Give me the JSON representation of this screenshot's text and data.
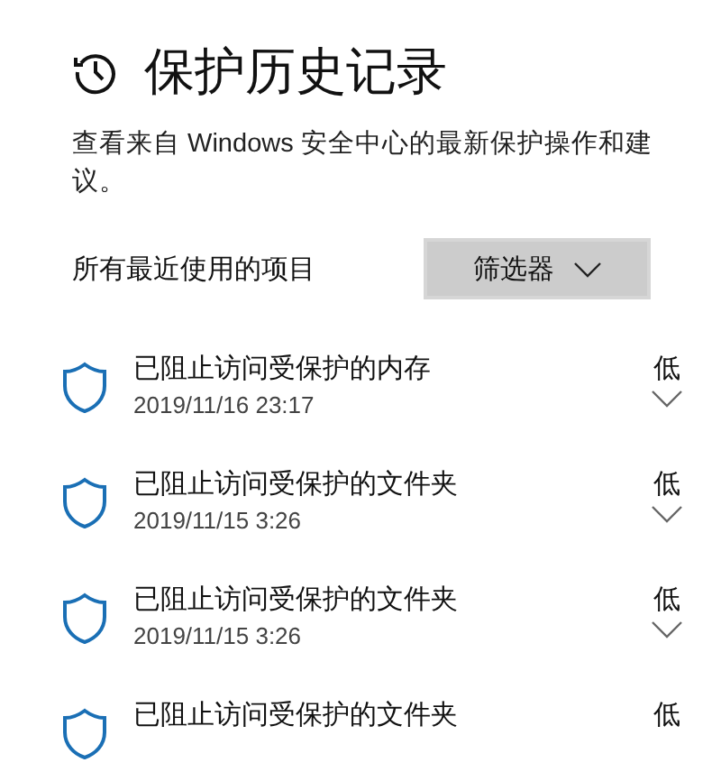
{
  "header": {
    "title": "保护历史记录",
    "description": "查看来自 Windows 安全中心的最新保护操作和建议。"
  },
  "filter_bar": {
    "label": "所有最近使用的项目",
    "button": "筛选器"
  },
  "items": [
    {
      "title": "已阻止访问受保护的内存",
      "date": "2019/11/16 23:17",
      "severity": "低",
      "expanded": false
    },
    {
      "title": "已阻止访问受保护的文件夹",
      "date": "2019/11/15 3:26",
      "severity": "低",
      "expanded": false
    },
    {
      "title": "已阻止访问受保护的文件夹",
      "date": "2019/11/15 3:26",
      "severity": "低",
      "expanded": false
    },
    {
      "title": "已阻止访问受保护的文件夹",
      "severity": "低"
    }
  ]
}
